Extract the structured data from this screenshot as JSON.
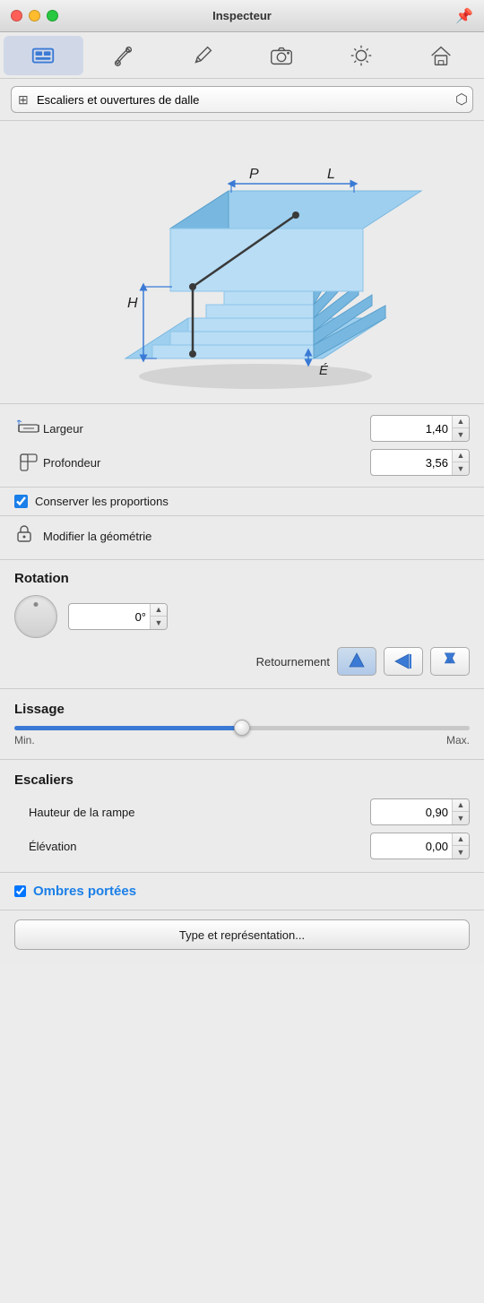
{
  "titlebar": {
    "title": "Inspecteur",
    "pin_symbol": "📌"
  },
  "toolbar": {
    "icons": [
      {
        "name": "structure-icon",
        "active": true
      },
      {
        "name": "paint-icon",
        "active": false
      },
      {
        "name": "pencil-icon",
        "active": false
      },
      {
        "name": "camera-icon",
        "active": false
      },
      {
        "name": "sun-icon",
        "active": false
      },
      {
        "name": "house-icon",
        "active": false
      }
    ]
  },
  "dropdown": {
    "value": "Escaliers et ou...rtures de dalle",
    "options": [
      "Escaliers et ouvertures de dalle"
    ]
  },
  "dimensions": {
    "largeur_label": "Largeur",
    "largeur_value": "1,40",
    "profondeur_label": "Profondeur",
    "profondeur_value": "3,56"
  },
  "proportions": {
    "label": "Conserver les proportions",
    "checked": true
  },
  "geometry": {
    "label": "Modifier la géométrie"
  },
  "rotation": {
    "title": "Rotation",
    "value": "0°",
    "retournement_label": "Retournement"
  },
  "lissage": {
    "title": "Lissage",
    "min_label": "Min.",
    "max_label": "Max.",
    "value": 50
  },
  "escaliers": {
    "title": "Escaliers",
    "hauteur_label": "Hauteur de la rampe",
    "hauteur_value": "0,90",
    "elevation_label": "Élévation",
    "elevation_value": "0,00"
  },
  "ombres": {
    "label": "Ombres portées",
    "checked": true
  },
  "type_btn": {
    "label": "Type et représentation..."
  }
}
